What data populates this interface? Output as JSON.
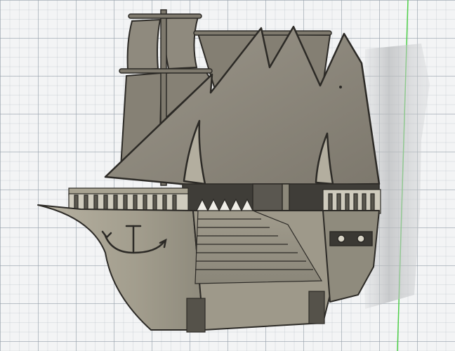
{
  "viewport": {
    "kind": "3d-model-viewport",
    "grid": true,
    "model": "pirate-ship-shelf",
    "colors": {
      "grid_background": "#f3f4f5",
      "grid_line": "#9aa3ab",
      "axis_line": "#4fd04a",
      "hull": "#aaa493",
      "hull_dark": "#7c776a",
      "sail": "#918c7f",
      "sail_dark": "#6e6a5f",
      "outline": "#2c2a26"
    }
  }
}
